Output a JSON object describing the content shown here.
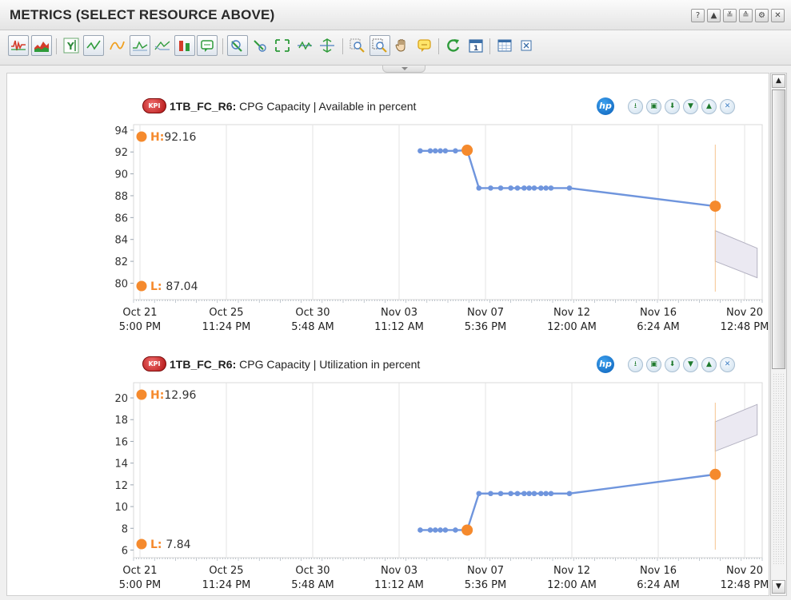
{
  "window": {
    "title": "METRICS (SELECT RESOURCE ABOVE)",
    "controls": [
      {
        "name": "help",
        "glyph": "?"
      },
      {
        "name": "collapse-up",
        "glyph": "▲"
      },
      {
        "name": "expand-down",
        "glyph": "≚"
      },
      {
        "name": "collapse-all",
        "glyph": "≙"
      },
      {
        "name": "settings",
        "glyph": "⚙"
      },
      {
        "name": "close",
        "glyph": "✕"
      }
    ]
  },
  "toolbar": {
    "icons": [
      "line-chart-icon",
      "area-chart-icon",
      "y-axis-icon",
      "trend-icon",
      "smooth-line-icon",
      "step-line-icon",
      "compare-icon",
      "threshold-icon",
      "annotation-icon",
      "clear-icon",
      "select-icon",
      "fit-icon",
      "normalize-icon",
      "spread-icon",
      "zoom-icon",
      "zoom-box-icon",
      "pan-icon",
      "comment-icon",
      "refresh-icon",
      "calendar-icon",
      "table-icon",
      "export-icon"
    ]
  },
  "charts": [
    {
      "resource": "1TB_FC_R6:",
      "metric": "CPG Capacity | Available in percent",
      "kpi": "KPI",
      "hp": "hp",
      "high_label": "H:",
      "high_value": "92.16",
      "low_label": "L:",
      "low_value": "87.04",
      "chart_data": {
        "type": "line",
        "y_ticks": [
          "94",
          "92",
          "90",
          "88",
          "86",
          "84",
          "82",
          "80"
        ],
        "ylim": [
          78.5,
          94.5
        ],
        "x_ticks": [
          {
            "date": "Oct 21",
            "time": "5:00 PM"
          },
          {
            "date": "Oct 25",
            "time": "11:24 PM"
          },
          {
            "date": "Oct 30",
            "time": "5:48 AM"
          },
          {
            "date": "Nov 03",
            "time": "11:12 AM"
          },
          {
            "date": "Nov 07",
            "time": "5:36 PM"
          },
          {
            "date": "Nov 12",
            "time": "12:00 AM"
          },
          {
            "date": "Nov 16",
            "time": "6:24 AM"
          },
          {
            "date": "Nov 20",
            "time": "12:48 PM"
          }
        ],
        "x_range_days": [
          0,
          37.5
        ],
        "series": [
          {
            "x_days": [
              17.1,
              17.7,
              18.0,
              18.3,
              18.6,
              19.2,
              19.9,
              20.6,
              21.3,
              21.9,
              22.5,
              22.9,
              23.3,
              23.6,
              23.9,
              24.3,
              24.6,
              24.9,
              26.0,
              34.7
            ],
            "values": [
              92.1,
              92.1,
              92.1,
              92.1,
              92.1,
              92.1,
              92.16,
              88.7,
              88.7,
              88.7,
              88.7,
              88.7,
              88.7,
              88.7,
              88.7,
              88.7,
              88.7,
              88.7,
              88.7,
              87.04
            ]
          }
        ],
        "highlight_points": [
          {
            "x_day": 19.9,
            "value": 92.16
          },
          {
            "x_day": 34.7,
            "value": 87.04
          }
        ],
        "forecast_band": {
          "x_day_start": 34.7,
          "x_day_end": 37.2,
          "upper": [
            84.8,
            83.2
          ],
          "lower": [
            82.0,
            80.5
          ]
        }
      }
    },
    {
      "resource": "1TB_FC_R6:",
      "metric": "CPG Capacity | Utilization in percent",
      "kpi": "KPI",
      "hp": "hp",
      "high_label": "H:",
      "high_value": "12.96",
      "low_label": "L:",
      "low_value": "7.84",
      "chart_data": {
        "type": "line",
        "y_ticks": [
          "20",
          "18",
          "16",
          "14",
          "12",
          "10",
          "8",
          "6"
        ],
        "ylim": [
          5.3,
          21.4
        ],
        "x_ticks": [
          {
            "date": "Oct 21",
            "time": "5:00 PM"
          },
          {
            "date": "Oct 25",
            "time": "11:24 PM"
          },
          {
            "date": "Oct 30",
            "time": "5:48 AM"
          },
          {
            "date": "Nov 03",
            "time": "11:12 AM"
          },
          {
            "date": "Nov 07",
            "time": "5:36 PM"
          },
          {
            "date": "Nov 12",
            "time": "12:00 AM"
          },
          {
            "date": "Nov 16",
            "time": "6:24 AM"
          },
          {
            "date": "Nov 20",
            "time": "12:48 PM"
          }
        ],
        "x_range_days": [
          0,
          37.5
        ],
        "series": [
          {
            "x_days": [
              17.1,
              17.7,
              18.0,
              18.3,
              18.6,
              19.2,
              19.9,
              20.6,
              21.3,
              21.9,
              22.5,
              22.9,
              23.3,
              23.6,
              23.9,
              24.3,
              24.6,
              24.9,
              26.0,
              34.7
            ],
            "values": [
              7.84,
              7.84,
              7.84,
              7.84,
              7.84,
              7.84,
              7.84,
              11.2,
              11.2,
              11.2,
              11.2,
              11.2,
              11.2,
              11.2,
              11.2,
              11.2,
              11.2,
              11.2,
              11.2,
              12.96
            ]
          }
        ],
        "highlight_points": [
          {
            "x_day": 19.9,
            "value": 7.84
          },
          {
            "x_day": 34.7,
            "value": 12.96
          }
        ],
        "forecast_band": {
          "x_day_start": 34.7,
          "x_day_end": 37.2,
          "upper": [
            17.8,
            19.4
          ],
          "lower": [
            15.1,
            16.6
          ]
        }
      }
    }
  ],
  "colors": {
    "line": "#6f95dd",
    "highlight": "#f58a2d",
    "grid": "#e3e3e3",
    "forecast_fill": "#ebe9f2",
    "forecast_stroke": "#b4b2c2"
  }
}
